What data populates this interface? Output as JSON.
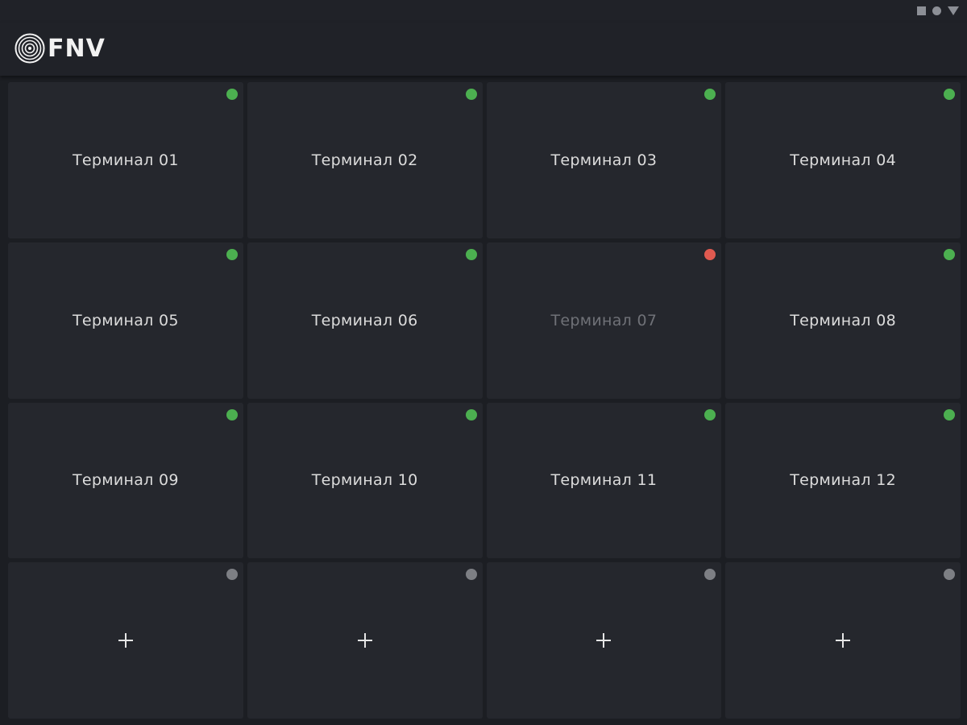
{
  "app": {
    "logo_text": "FNV"
  },
  "colors": {
    "online": "#4caf50",
    "error": "#e05a50",
    "empty": "#7d7f84"
  },
  "terminals": [
    {
      "label": "Терминал 01",
      "status": "online"
    },
    {
      "label": "Терминал 02",
      "status": "online"
    },
    {
      "label": "Терминал 03",
      "status": "online"
    },
    {
      "label": "Терминал 04",
      "status": "online"
    },
    {
      "label": "Терминал 05",
      "status": "online"
    },
    {
      "label": "Терминал 06",
      "status": "online"
    },
    {
      "label": "Терминал 07",
      "status": "error"
    },
    {
      "label": "Терминал 08",
      "status": "online"
    },
    {
      "label": "Терминал 09",
      "status": "online"
    },
    {
      "label": "Терминал 10",
      "status": "online"
    },
    {
      "label": "Терминал 11",
      "status": "online"
    },
    {
      "label": "Терминал 12",
      "status": "online"
    }
  ],
  "add_slots": [
    {
      "status": "empty",
      "icon": "plus-icon"
    },
    {
      "status": "empty",
      "icon": "plus-icon"
    },
    {
      "status": "empty",
      "icon": "plus-icon"
    },
    {
      "status": "empty",
      "icon": "plus-icon"
    }
  ]
}
